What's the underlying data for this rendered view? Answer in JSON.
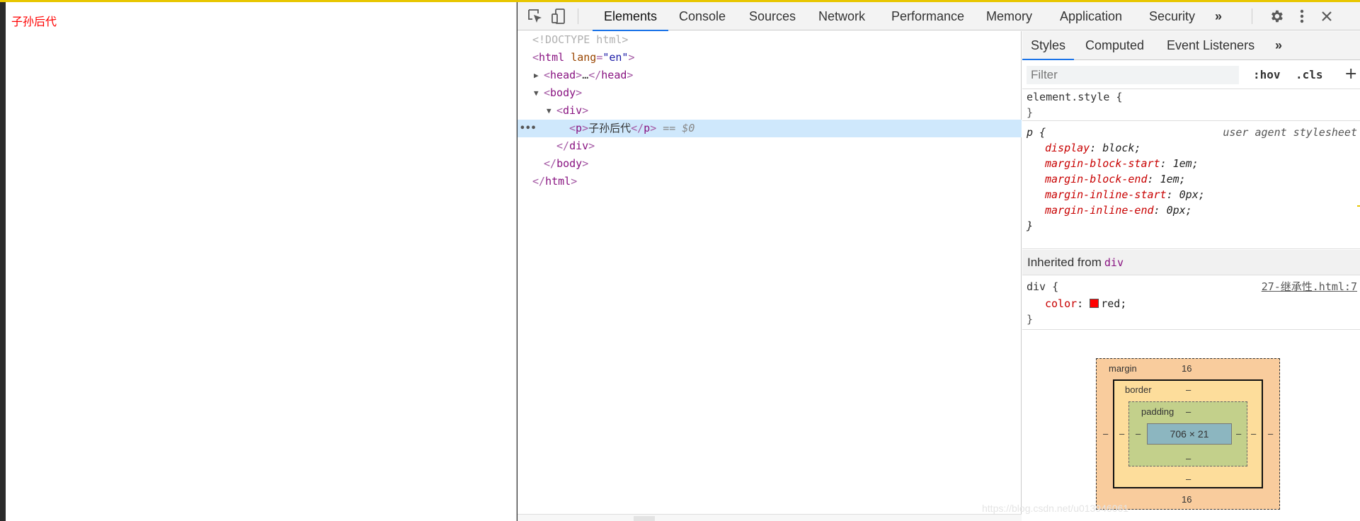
{
  "page": {
    "text": "子孙后代"
  },
  "devtools": {
    "tabs": [
      "Elements",
      "Console",
      "Sources",
      "Network",
      "Performance",
      "Memory",
      "Application",
      "Security"
    ],
    "active_tab": "Elements",
    "more_tabs": "»",
    "dom": {
      "doctype": "<!DOCTYPE html>",
      "html_open_tag": "html",
      "html_attr": "lang",
      "html_attr_val": "\"en\"",
      "head_tag": "head",
      "head_ellipsis": "…",
      "body_tag": "body",
      "div_tag": "div",
      "p_tag": "p",
      "p_text": "子孙后代",
      "selected_marker": "== $0",
      "dots": "•••"
    },
    "styles_pane": {
      "tabs": [
        "Styles",
        "Computed",
        "Event Listeners"
      ],
      "more_tabs": "»",
      "filter_placeholder": "Filter",
      "hov": ":hov",
      "cls": ".cls",
      "plus": "+",
      "element_style": "element.style {",
      "close_brace": "}",
      "rule1": {
        "selector": "p {",
        "origin": "user agent stylesheet",
        "props": [
          {
            "name": "display",
            "value": "block;"
          },
          {
            "name": "margin-block-start",
            "value": "1em;"
          },
          {
            "name": "margin-block-end",
            "value": "1em;"
          },
          {
            "name": "margin-inline-start",
            "value": "0px;"
          },
          {
            "name": "margin-inline-end",
            "value": "0px;"
          }
        ]
      },
      "inherited_label": "Inherited from",
      "inherited_tag": "div",
      "rule2": {
        "selector": "div {",
        "source": "27-继承性.html:7",
        "prop_name": "color",
        "prop_value": "red;",
        "swatch_color": "#ff0000"
      },
      "box_model": {
        "margin_label": "margin",
        "margin_top": "16",
        "margin_bottom": "16",
        "margin_left": "–",
        "margin_right": "–",
        "border_label": "border",
        "border_top": "–",
        "border_bottom": "–",
        "border_left": "–",
        "border_right": "–",
        "padding_label": "padding",
        "padding_top": "–",
        "padding_bottom": "–",
        "padding_left": "–",
        "padding_right": "–",
        "content": "706 × 21"
      }
    }
  },
  "watermark": "https://blog.csdn.net/u013946061",
  "colors": {
    "accent": "#1a73e8",
    "top_bar": "#e8c600",
    "selected_row": "#cfe8fc"
  }
}
